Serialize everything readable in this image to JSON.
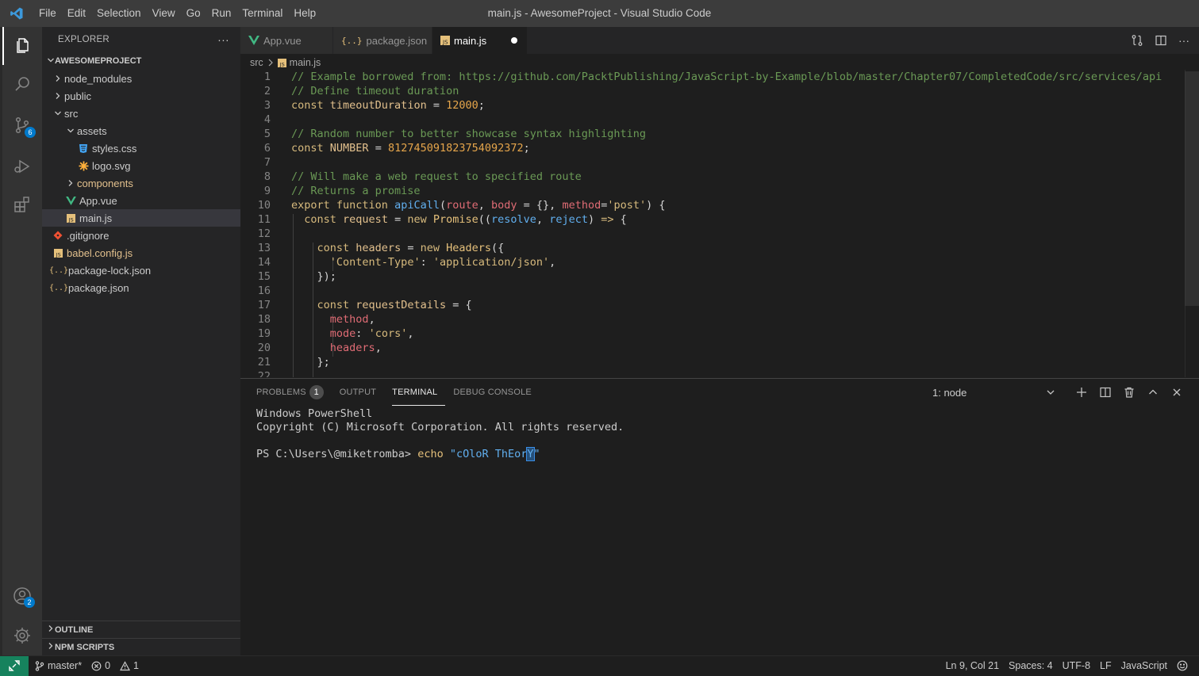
{
  "window": {
    "title": "main.js - AwesomeProject - Visual Studio Code",
    "menu": [
      "File",
      "Edit",
      "Selection",
      "View",
      "Go",
      "Run",
      "Terminal",
      "Help"
    ]
  },
  "activity_bar": {
    "source_control_badge": "6",
    "accounts_badge": "2"
  },
  "sidebar": {
    "title": "EXPLORER",
    "more_label": "···",
    "project": "AWESOMEPROJECT",
    "tree": [
      {
        "label": "node_modules",
        "type": "folder",
        "expanded": false,
        "depth": 1
      },
      {
        "label": "public",
        "type": "folder",
        "expanded": false,
        "depth": 1
      },
      {
        "label": "src",
        "type": "folder",
        "expanded": true,
        "depth": 1
      },
      {
        "label": "assets",
        "type": "folder",
        "expanded": true,
        "depth": 2
      },
      {
        "label": "styles.css",
        "type": "css",
        "depth": 3
      },
      {
        "label": "logo.svg",
        "type": "svg",
        "depth": 3
      },
      {
        "label": "components",
        "type": "folder",
        "expanded": false,
        "depth": 2
      },
      {
        "label": "App.vue",
        "type": "vue",
        "depth": 2
      },
      {
        "label": "main.js",
        "type": "js",
        "depth": 2,
        "selected": true
      },
      {
        "label": ".gitignore",
        "type": "git",
        "depth": 1
      },
      {
        "label": "babel.config.js",
        "type": "js",
        "depth": 1
      },
      {
        "label": "package-lock.json",
        "type": "json",
        "depth": 1
      },
      {
        "label": "package.json",
        "type": "json",
        "depth": 1
      }
    ],
    "outline_label": "OUTLINE",
    "npm_label": "NPM SCRIPTS"
  },
  "tabs": [
    {
      "label": "App.vue",
      "icon": "vue-icon",
      "active": false
    },
    {
      "label": "package.json",
      "icon": "json-icon",
      "active": false
    },
    {
      "label": "main.js",
      "icon": "js-icon",
      "active": true,
      "dirty": true
    }
  ],
  "breadcrumb": {
    "folder": "src",
    "file": "main.js"
  },
  "editor": {
    "lines": [
      {
        "n": "1",
        "tokens": [
          [
            "c-comment",
            "// Example borrowed from: https://github.com/PacktPublishing/JavaScript-by-Example/blob/master/Chapter07/CompletedCode/src/services/api"
          ]
        ]
      },
      {
        "n": "2",
        "tokens": [
          [
            "c-comment",
            "// Define timeout duration"
          ]
        ]
      },
      {
        "n": "3",
        "tokens": [
          [
            "c-kw",
            "const "
          ],
          [
            "c-var",
            "timeoutDuration "
          ],
          [
            "c-op",
            "= "
          ],
          [
            "c-num",
            "12000"
          ],
          [
            "c-op",
            ";"
          ]
        ]
      },
      {
        "n": "4",
        "tokens": []
      },
      {
        "n": "5",
        "tokens": [
          [
            "c-comment",
            "// Random number to better showcase syntax highlighting"
          ]
        ]
      },
      {
        "n": "6",
        "tokens": [
          [
            "c-kw",
            "const "
          ],
          [
            "c-var",
            "NUMBER "
          ],
          [
            "c-op",
            "= "
          ],
          [
            "c-num",
            "812745091823754092372"
          ],
          [
            "c-op",
            ";"
          ]
        ]
      },
      {
        "n": "7",
        "tokens": []
      },
      {
        "n": "8",
        "tokens": [
          [
            "c-comment",
            "// Will make a web request to specified route"
          ]
        ]
      },
      {
        "n": "9",
        "tokens": [
          [
            "c-comment",
            "// Returns a promise"
          ]
        ]
      },
      {
        "n": "10",
        "tokens": [
          [
            "c-kw",
            "export "
          ],
          [
            "c-kw",
            "function "
          ],
          [
            "c-fn",
            "apiCall"
          ],
          [
            "c-op",
            "("
          ],
          [
            "c-param",
            "route"
          ],
          [
            "c-op",
            ", "
          ],
          [
            "c-param",
            "body "
          ],
          [
            "c-op",
            "= {}, "
          ],
          [
            "c-param",
            "method"
          ],
          [
            "c-op",
            "="
          ],
          [
            "c-str",
            "'post'"
          ],
          [
            "c-op",
            ") {"
          ]
        ]
      },
      {
        "n": "11",
        "tokens": [
          [
            "c-op",
            "  "
          ],
          [
            "c-kw",
            "const "
          ],
          [
            "c-var",
            "request "
          ],
          [
            "c-op",
            "= "
          ],
          [
            "c-kw",
            "new "
          ],
          [
            "c-cls",
            "Promise"
          ],
          [
            "c-op",
            "(("
          ],
          [
            "c-fn",
            "resolve"
          ],
          [
            "c-op",
            ", "
          ],
          [
            "c-fn",
            "reject"
          ],
          [
            "c-op",
            ") "
          ],
          [
            "c-kw",
            "=> "
          ],
          [
            "c-op",
            "{"
          ]
        ]
      },
      {
        "n": "12",
        "tokens": []
      },
      {
        "n": "13",
        "tokens": [
          [
            "c-op",
            "    "
          ],
          [
            "c-kw",
            "const "
          ],
          [
            "c-var",
            "headers "
          ],
          [
            "c-op",
            "= "
          ],
          [
            "c-kw",
            "new "
          ],
          [
            "c-cls",
            "Headers"
          ],
          [
            "c-op",
            "({"
          ]
        ]
      },
      {
        "n": "14",
        "tokens": [
          [
            "c-op",
            "      "
          ],
          [
            "c-str",
            "'Content-Type'"
          ],
          [
            "c-op",
            ": "
          ],
          [
            "c-str",
            "'application/json'"
          ],
          [
            "c-op",
            ","
          ]
        ]
      },
      {
        "n": "15",
        "tokens": [
          [
            "c-op",
            "    });"
          ]
        ]
      },
      {
        "n": "16",
        "tokens": []
      },
      {
        "n": "17",
        "tokens": [
          [
            "c-op",
            "    "
          ],
          [
            "c-kw",
            "const "
          ],
          [
            "c-var",
            "requestDetails "
          ],
          [
            "c-op",
            "= {"
          ]
        ]
      },
      {
        "n": "18",
        "tokens": [
          [
            "c-op",
            "      "
          ],
          [
            "c-prop",
            "method"
          ],
          [
            "c-op",
            ","
          ]
        ]
      },
      {
        "n": "19",
        "tokens": [
          [
            "c-op",
            "      "
          ],
          [
            "c-prop",
            "mode"
          ],
          [
            "c-op",
            ": "
          ],
          [
            "c-str",
            "'cors'"
          ],
          [
            "c-op",
            ","
          ]
        ]
      },
      {
        "n": "20",
        "tokens": [
          [
            "c-op",
            "      "
          ],
          [
            "c-prop",
            "headers"
          ],
          [
            "c-op",
            ","
          ]
        ]
      },
      {
        "n": "21",
        "tokens": [
          [
            "c-op",
            "    };"
          ]
        ]
      },
      {
        "n": "22",
        "tokens": []
      }
    ]
  },
  "panel": {
    "tabs": [
      {
        "label": "PROBLEMS",
        "badge": "1",
        "active": false
      },
      {
        "label": "OUTPUT",
        "active": false
      },
      {
        "label": "TERMINAL",
        "active": true
      },
      {
        "label": "DEBUG CONSOLE",
        "active": false
      }
    ],
    "terminal_instance": "1: node",
    "terminal": {
      "line1": "Windows PowerShell",
      "line2": "Copyright (C) Microsoft Corporation. All rights reserved.",
      "prompt": "PS C:\\Users\\@miketromba> ",
      "command": "echo",
      "arg_before_cursor": "\"cOloR ThEor",
      "cursor_char": "Y",
      "arg_after_cursor": "\""
    }
  },
  "statusbar": {
    "branch": "master*",
    "errors": "0",
    "warnings": "1",
    "position": "Ln 9, Col 21",
    "spaces": "Spaces: 4",
    "encoding": "UTF-8",
    "eol": "LF",
    "language": "JavaScript"
  },
  "colors": {
    "accent": "#007acc",
    "remote": "#16825d",
    "editor_bg": "#1e1e1e"
  }
}
